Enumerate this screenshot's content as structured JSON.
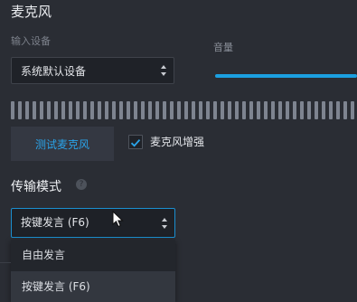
{
  "microphone": {
    "section_title": "麦克风",
    "input_device_label": "输入设备",
    "input_device_value": "系统默认设备",
    "volume_label": "音量",
    "volume_level_percent": 100,
    "meter_bar_count": 48,
    "test_button_label": "测试麦克风",
    "enhance_label": "麦克风增强",
    "enhance_checked": true
  },
  "transmission": {
    "title": "传输模式",
    "selected_value": "按键发言 (F6)",
    "options": [
      "自由发言",
      "按键发言 (F6)"
    ],
    "highlighted_option": "按键发言 (F6)"
  },
  "colors": {
    "background": "#2a2d34",
    "accent": "#1b9fe0",
    "link_text": "#2aa4ea",
    "meter_bar": "#7e8490"
  },
  "icons": {
    "select_arrows": "up-down-arrows-icon",
    "checkbox": "checkmark-icon",
    "help": "question-circle-icon",
    "cursor": "mouse-pointer-icon"
  }
}
